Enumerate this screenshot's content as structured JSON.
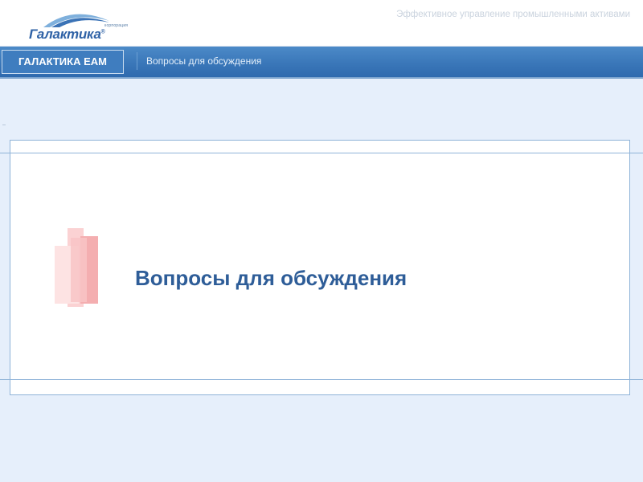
{
  "header": {
    "logo_small": "корпорация",
    "logo_word": "Галактика",
    "logo_mark": "®",
    "tagline": "Эффективное управление промышленными активами"
  },
  "navbar": {
    "brand": "ГАЛАКТИКА EAM",
    "breadcrumb": "Вопросы для обсуждения"
  },
  "slide": {
    "title": "Вопросы для обсуждения"
  },
  "colors": {
    "nav_blue": "#3a77b9",
    "title_blue": "#2e5d98",
    "background": "#e6effb",
    "accent_pink": "#f4aeb0"
  },
  "icons": [
    "galaktika-logo-icon",
    "pink-bars-decoration-icon"
  ]
}
